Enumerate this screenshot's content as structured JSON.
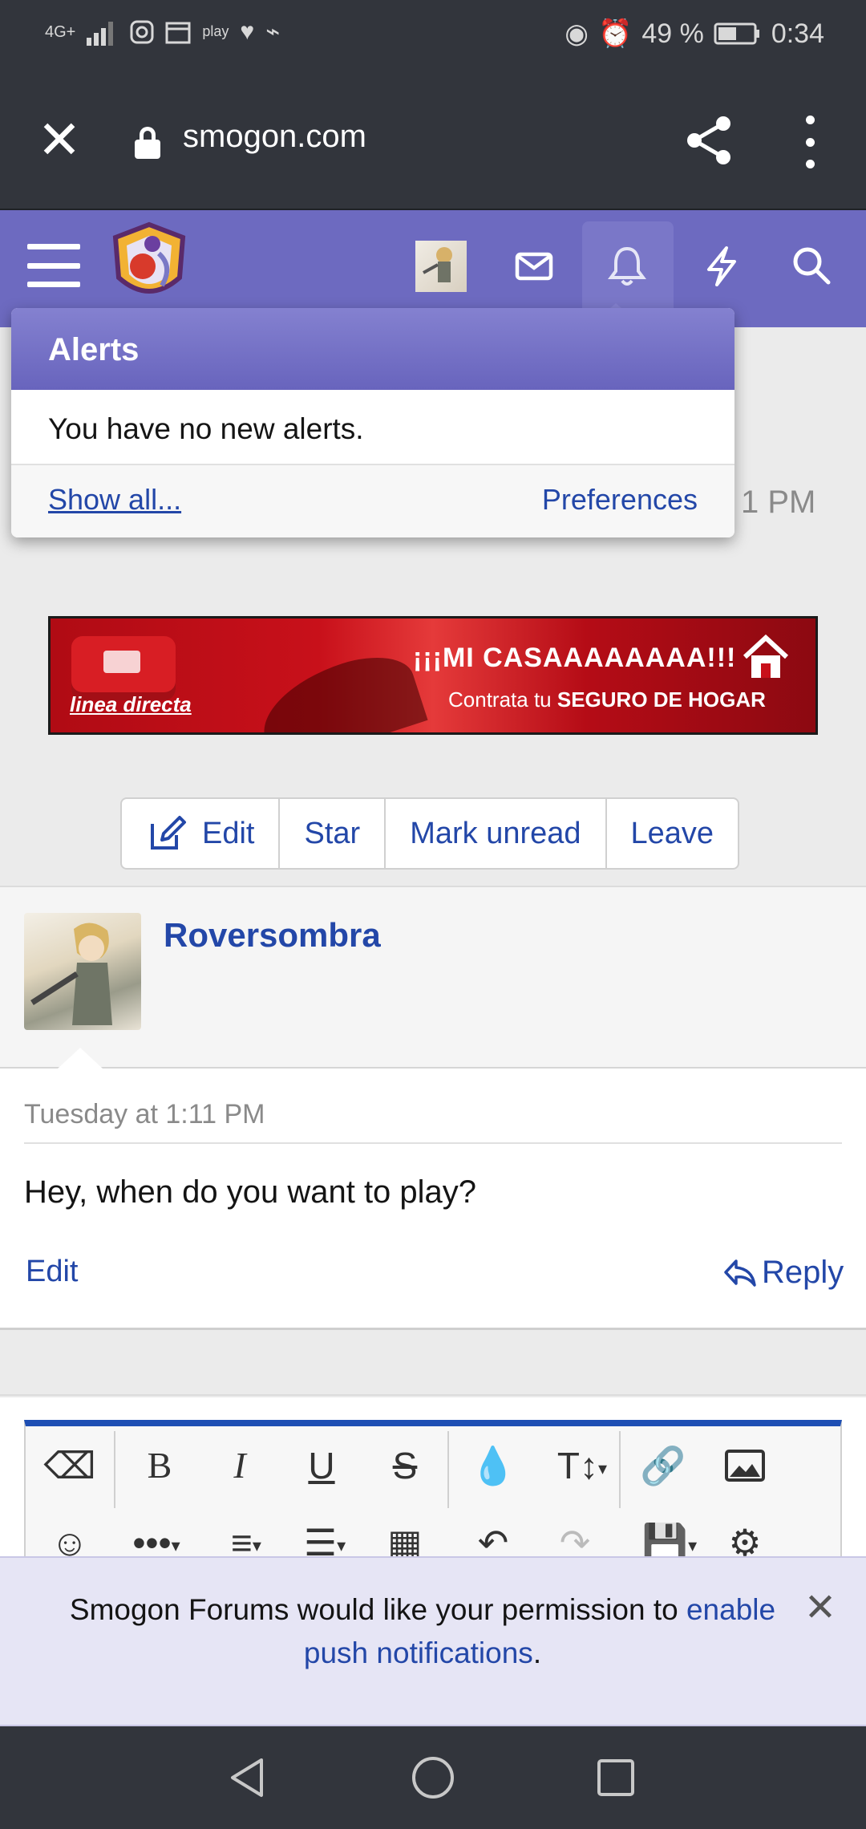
{
  "status_bar": {
    "network": "4G+",
    "carrier_icon": "play",
    "battery_percent": "49 %",
    "time": "0:34"
  },
  "browser": {
    "url": "smogon.com"
  },
  "header": {
    "icons": [
      "menu-icon",
      "mail-icon",
      "bell-icon",
      "lightning-icon",
      "search-icon"
    ]
  },
  "alerts": {
    "title": "Alerts",
    "empty_text": "You have no new alerts.",
    "show_all": "Show all...",
    "preferences": "Preferences"
  },
  "page": {
    "time_peek": "1 PM"
  },
  "ad": {
    "brand": "linea directa",
    "headline": "¡¡¡MI CASAAAAAAAA!!!",
    "sub_prefix": "Contrata tu",
    "sub_bold": "SEGURO DE HOGAR"
  },
  "actions": {
    "edit": "Edit",
    "star": "Star",
    "mark_unread": "Mark unread",
    "leave": "Leave"
  },
  "message": {
    "username": "Roversombra",
    "date": "Tuesday at 1:11 PM",
    "text": "Hey, when do you want to play?",
    "edit": "Edit",
    "reply": "Reply"
  },
  "push": {
    "text_before": "Smogon Forums would like your permission to ",
    "link": "enable push notifications",
    "text_after": "."
  },
  "colors": {
    "header_purple": "#6d6ac0",
    "link_blue": "#2347a8",
    "system_bar": "#32353c"
  }
}
